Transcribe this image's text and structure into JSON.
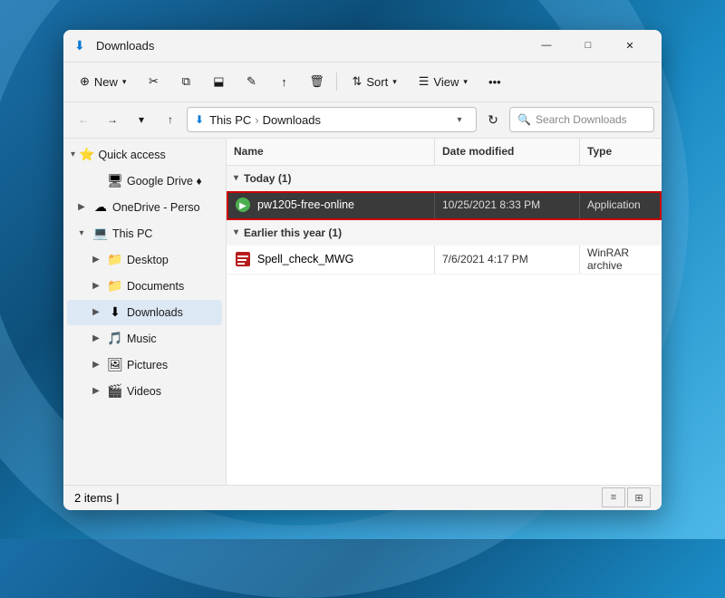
{
  "window": {
    "title": "Downloads",
    "controls": {
      "minimize": "—",
      "maximize": "□",
      "close": "✕"
    }
  },
  "toolbar": {
    "new_label": "New",
    "new_caret": "▾",
    "cut_icon": "✂",
    "copy_icon": "⧉",
    "paste_icon": "📋",
    "rename_icon": "✎",
    "share_icon": "⬕",
    "delete_icon": "🗑",
    "sort_label": "Sort",
    "sort_caret": "▾",
    "view_label": "View",
    "view_caret": "▾",
    "more_icon": "•••"
  },
  "addressbar": {
    "back_icon": "←",
    "forward_icon": "→",
    "recent_icon": "▾",
    "up_icon": "↑",
    "path_icon": "⬇",
    "breadcrumbs": [
      "This PC",
      "Downloads"
    ],
    "dropdown_icon": "▾",
    "refresh_icon": "↻",
    "search_placeholder": "Search Downloads",
    "search_icon": "🔍"
  },
  "sidebar": {
    "quick_access_label": "Quick access",
    "quick_access_icon": "⭐",
    "quick_access_expanded": true,
    "items": [
      {
        "id": "google-drive",
        "label": "Google Drive ♦",
        "icon": "🖥",
        "indent": 1
      },
      {
        "id": "onedrive",
        "label": "OneDrive - Perso",
        "icon": "☁",
        "indent": 0,
        "expand": "▶"
      },
      {
        "id": "this-pc",
        "label": "This PC",
        "icon": "💻",
        "indent": 0,
        "expand": "▼",
        "expanded": true
      },
      {
        "id": "desktop",
        "label": "Desktop",
        "icon": "📁",
        "indent": 1,
        "expand": "▶"
      },
      {
        "id": "documents",
        "label": "Documents",
        "icon": "📁",
        "indent": 1,
        "expand": "▶"
      },
      {
        "id": "downloads",
        "label": "Downloads",
        "icon": "⬇",
        "indent": 1,
        "expand": "▶",
        "active": true
      },
      {
        "id": "music",
        "label": "Music",
        "icon": "🎵",
        "indent": 1,
        "expand": "▶"
      },
      {
        "id": "pictures",
        "label": "Pictures",
        "icon": "🖼",
        "indent": 1,
        "expand": "▶"
      },
      {
        "id": "videos",
        "label": "Videos",
        "icon": "🎬",
        "indent": 1,
        "expand": "▶"
      }
    ]
  },
  "file_list": {
    "columns": {
      "name": "Name",
      "date_modified": "Date modified",
      "type": "Type"
    },
    "groups": [
      {
        "id": "today",
        "label": "Today (1)",
        "files": [
          {
            "id": "pw1205",
            "name": "pw1205-free-online",
            "icon": "🟢",
            "date_modified": "10/25/2021 8:33 PM",
            "type": "Application",
            "selected": true
          }
        ]
      },
      {
        "id": "earlier-this-year",
        "label": "Earlier this year (1)",
        "files": [
          {
            "id": "spell-check",
            "name": "Spell_check_MWG",
            "icon": "📦",
            "date_modified": "7/6/2021 4:17 PM",
            "type": "WinRAR archive",
            "selected": false
          }
        ]
      }
    ]
  },
  "statusbar": {
    "items_count": "2 items",
    "cursor": "|",
    "view_detail_icon": "≡",
    "view_large_icon": "⊞"
  }
}
